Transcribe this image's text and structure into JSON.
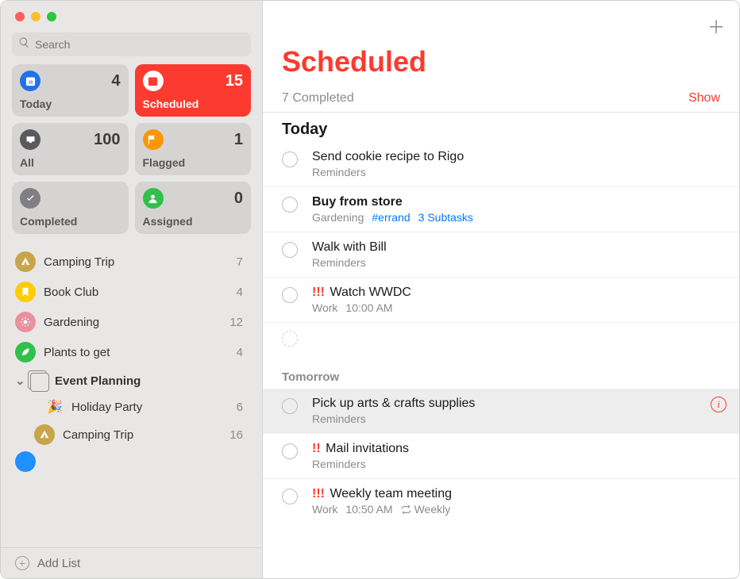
{
  "search": {
    "placeholder": "Search"
  },
  "smart": {
    "today": {
      "label": "Today",
      "count": "4",
      "color": "#2172e8"
    },
    "scheduled": {
      "label": "Scheduled",
      "count": "15",
      "color": "#fc3a30"
    },
    "all": {
      "label": "All",
      "count": "100",
      "color": "#5a5a5e"
    },
    "flagged": {
      "label": "Flagged",
      "count": "1",
      "color": "#ff9500"
    },
    "completed": {
      "label": "Completed",
      "count": "",
      "color": "#7f7f84"
    },
    "assigned": {
      "label": "Assigned",
      "count": "0",
      "color": "#30c04b"
    }
  },
  "lists": [
    {
      "name": "Camping Trip",
      "count": "7",
      "color": "#c8a44b",
      "icon": "tent"
    },
    {
      "name": "Book Club",
      "count": "4",
      "color": "#ffcc00",
      "icon": "bookmark"
    },
    {
      "name": "Gardening",
      "count": "12",
      "color": "#e8919d",
      "icon": "sun"
    },
    {
      "name": "Plants to get",
      "count": "4",
      "color": "#30c04b",
      "icon": "leaf"
    }
  ],
  "group": {
    "name": "Event Planning",
    "children": [
      {
        "name": "Holiday Party",
        "count": "6",
        "emoji": "🎉"
      },
      {
        "name": "Camping Trip",
        "count": "16",
        "color": "#c8a44b",
        "icon": "tent"
      }
    ]
  },
  "footer": {
    "add_list": "Add List"
  },
  "main": {
    "title": "Scheduled",
    "completed_text": "7 Completed",
    "show_label": "Show",
    "sections": {
      "today": {
        "title": "Today",
        "tasks": [
          {
            "title": "Send cookie recipe to Rigo",
            "list": "Reminders"
          },
          {
            "title": "Buy from store",
            "bold": true,
            "list": "Gardening",
            "tag": "#errand",
            "subtasks": "3 Subtasks"
          },
          {
            "title": "Walk with Bill",
            "list": "Reminders"
          },
          {
            "priority": "!!!",
            "title": "Watch WWDC",
            "list": "Work",
            "time": "10:00 AM"
          }
        ]
      },
      "tomorrow": {
        "title": "Tomorrow",
        "tasks": [
          {
            "title": "Pick up arts & crafts supplies",
            "list": "Reminders",
            "selected": true,
            "info": true
          },
          {
            "priority": "!!",
            "title": "Mail invitations",
            "list": "Reminders"
          },
          {
            "priority": "!!!",
            "title": "Weekly team meeting",
            "list": "Work",
            "time": "10:50 AM",
            "repeat": "Weekly"
          }
        ]
      }
    }
  }
}
